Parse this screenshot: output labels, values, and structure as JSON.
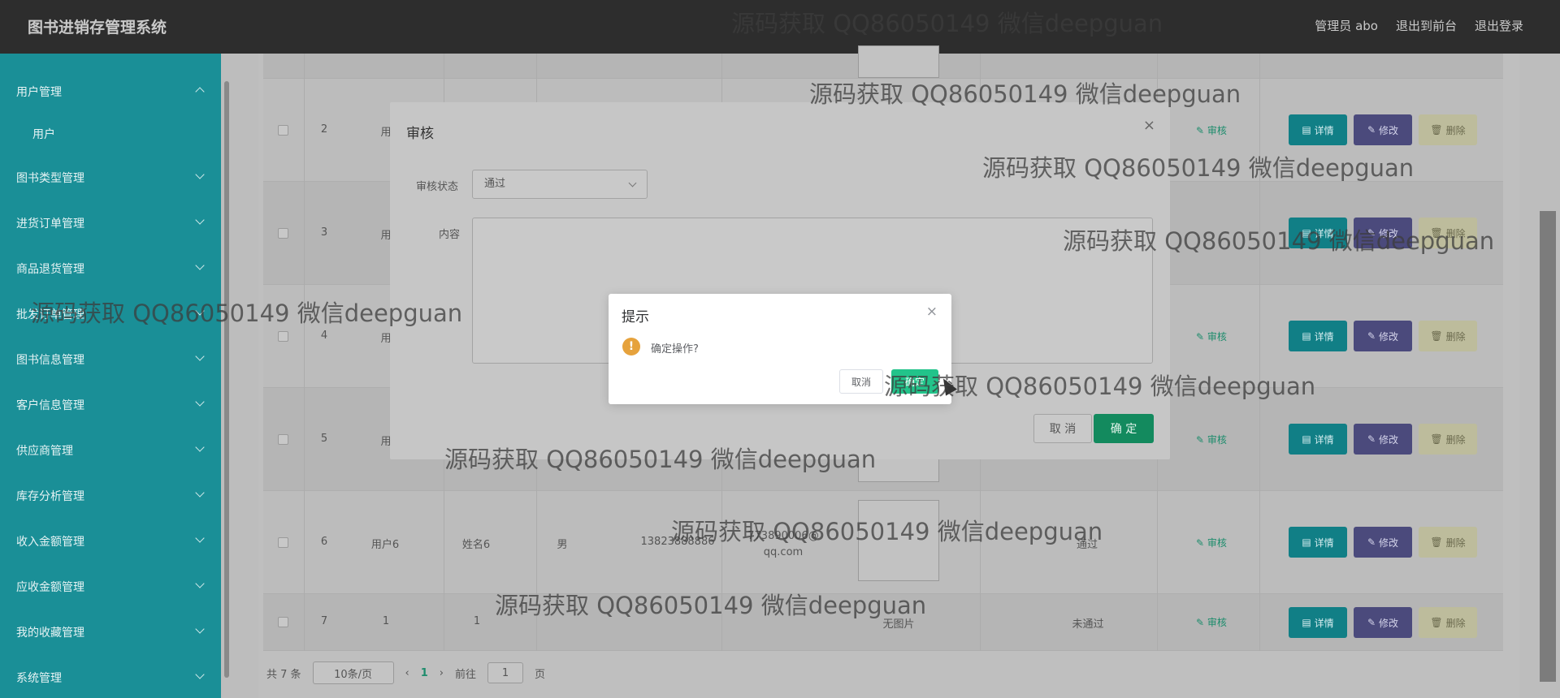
{
  "header": {
    "title": "图书进销存管理系统",
    "user_label": "管理员 abo",
    "front_link": "退出到前台",
    "logout_link": "退出登录"
  },
  "sidebar": {
    "items": [
      {
        "label": "用户管理"
      },
      {
        "label": "用户"
      },
      {
        "label": "图书类型管理"
      },
      {
        "label": "进货订单管理"
      },
      {
        "label": "商品退货管理"
      },
      {
        "label": "批发订单管理"
      },
      {
        "label": "图书信息管理"
      },
      {
        "label": "客户信息管理"
      },
      {
        "label": "供应商管理"
      },
      {
        "label": "库存分析管理"
      },
      {
        "label": "收入金额管理"
      },
      {
        "label": "应收金额管理"
      },
      {
        "label": "我的收藏管理"
      },
      {
        "label": "系统管理"
      }
    ]
  },
  "table": {
    "rows": [
      {
        "index": "2",
        "account": "用",
        "name": "",
        "gender": "",
        "phone": "",
        "email": "",
        "status": ""
      },
      {
        "index": "3",
        "account": "用",
        "name": "",
        "gender": "",
        "phone": "",
        "email": "",
        "status": ""
      },
      {
        "index": "4",
        "account": "用",
        "name": "",
        "gender": "",
        "phone": "",
        "email": "",
        "status": ""
      },
      {
        "index": "5",
        "account": "用",
        "name": "",
        "gender": "",
        "phone": "",
        "email": "",
        "status": ""
      },
      {
        "index": "6",
        "account": "用户6",
        "name": "姓名6",
        "gender": "男",
        "phone": "13823888886",
        "email": "773890006@",
        "email2": "qq.com",
        "status": "通过"
      },
      {
        "index": "7",
        "account": "1",
        "name": "1",
        "gender": "",
        "phone": "",
        "email": "",
        "no_image": "无图片",
        "status": "未通过"
      }
    ],
    "actions": {
      "audit": "审核",
      "detail": "详情",
      "edit": "修改",
      "delete": "删除"
    }
  },
  "pager": {
    "total": "共 7 条",
    "page_size": "10条/页",
    "prev": "‹",
    "current": "1",
    "next": "›",
    "goto_prefix": "前往",
    "goto_value": "1",
    "goto_suffix": "页"
  },
  "audit_dialog": {
    "title": "审核",
    "status_label": "审核状态",
    "status_value": "通过",
    "content_label": "内容",
    "cancel": "取 消",
    "confirm": "确 定"
  },
  "confirm_box": {
    "title": "提示",
    "message": "确定操作?",
    "cancel": "取消",
    "confirm": "确定"
  },
  "watermark": "源码获取 QQ86050149 微信deepguan",
  "colors": {
    "sidebar": "#1a8f97",
    "header": "#2d2d2d",
    "primary": "#22c38a",
    "warning": "#e6a23c"
  }
}
